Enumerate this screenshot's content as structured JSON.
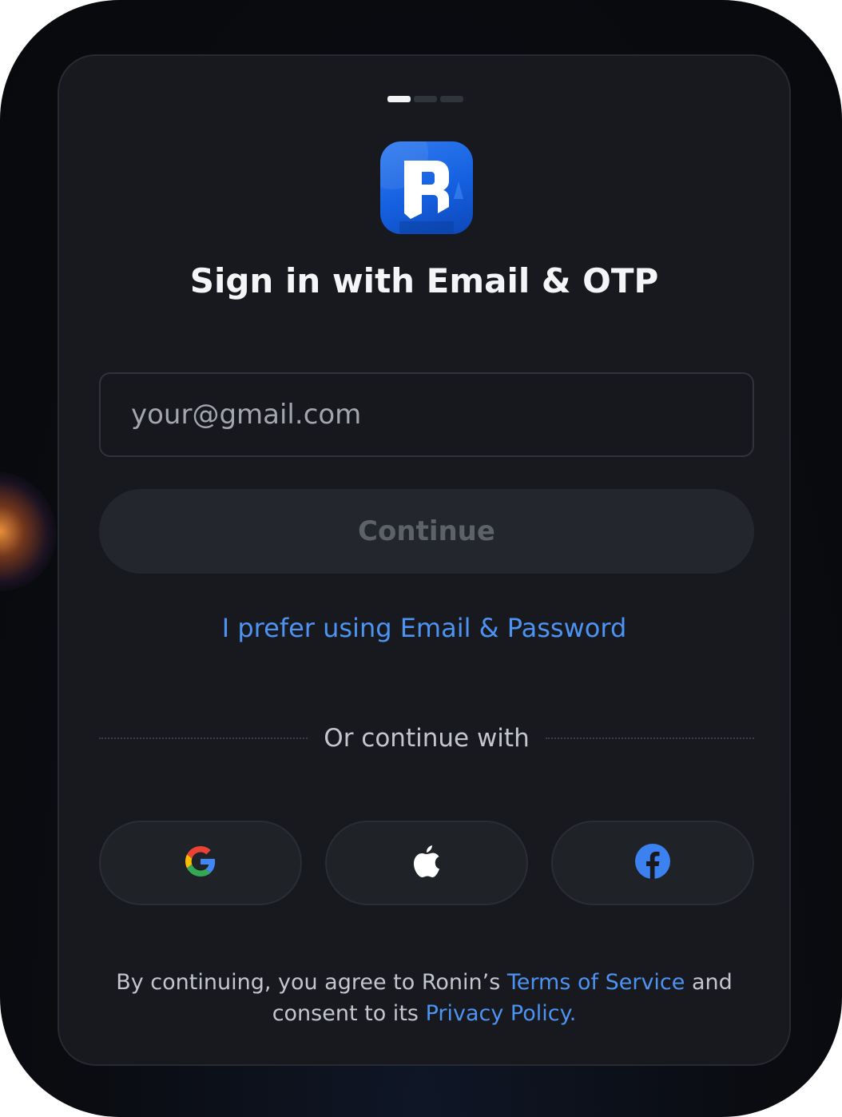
{
  "progress": {
    "total_steps": 3,
    "current_step": 1
  },
  "brand": {
    "logo_icon": "ronin-logo-icon",
    "accent": "#1f6ff0"
  },
  "title": "Sign in with Email & OTP",
  "email": {
    "placeholder": "your@gmail.com",
    "value": ""
  },
  "continue_label": "Continue",
  "alt_link_label": "I prefer using Email & Password",
  "divider_label": "Or continue with",
  "social": [
    {
      "name": "google",
      "icon": "google-icon"
    },
    {
      "name": "apple",
      "icon": "apple-icon"
    },
    {
      "name": "facebook",
      "icon": "facebook-icon"
    }
  ],
  "legal": {
    "prefix": "By continuing, you agree to Ronin’s ",
    "terms_label": "Terms of Service",
    "middle": " and consent to its ",
    "privacy_label": "Privacy Policy."
  },
  "colors": {
    "link": "#4d93f2",
    "card_background": "#17191e",
    "disabled_text": "#5d6169"
  }
}
